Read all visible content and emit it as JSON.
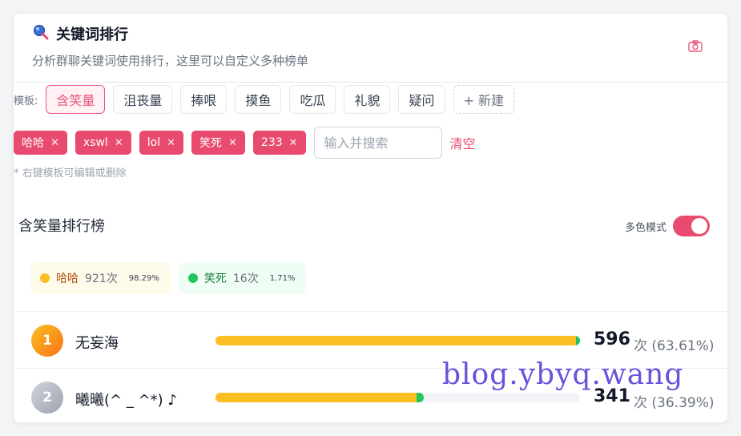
{
  "header": {
    "title": "关键词排行",
    "subtitle": "分析群聊关键词使用排行，这里可以自定义多种榜单",
    "search_icon": "magnifier-icon",
    "camera_icon": "camera-icon"
  },
  "templates": {
    "label": "模板:",
    "items": [
      "含笑量",
      "沮丧量",
      "捧哏",
      "摸鱼",
      "吃瓜",
      "礼貌",
      "疑问"
    ],
    "active_index": 0,
    "new_label": "+ 新建",
    "hint": "* 右键模板可编辑或删除"
  },
  "tags": [
    "哈哈",
    "xswl",
    "lol",
    "笑死",
    "233"
  ],
  "search": {
    "placeholder": "输入并搜索",
    "value": "",
    "clear_label": "清空"
  },
  "ranking": {
    "title": "含笑量排行榜",
    "mode_label": "多色模式",
    "mode_on": true,
    "stats": [
      {
        "keyword": "哈哈",
        "count": "921次",
        "percent": "98.29%",
        "color": "#fbbf24",
        "bg": "#fffbeb",
        "text_color": "#b45309"
      },
      {
        "keyword": "笑死",
        "count": "16次",
        "percent": "1.71%",
        "color": "#22c55e",
        "bg": "#effdf4",
        "text_color": "#15803d"
      }
    ],
    "rows": [
      {
        "rank": "1",
        "name": "无妄海",
        "count": "596",
        "unit": "次 (63.61%)",
        "fill": 1.0,
        "green": 0.01,
        "badge": "gold"
      },
      {
        "rank": "2",
        "name": "曦曦(^ _ ^*) ♪",
        "count": "341",
        "unit": "次 (36.39%)",
        "fill": 0.572,
        "green": 0.02,
        "badge": "silver"
      }
    ]
  },
  "colors": {
    "accent": "#e84b6e",
    "bar_main": "#fbbf24",
    "bar_secondary": "#22c55e"
  },
  "watermark": "blog.ybyq.wang"
}
